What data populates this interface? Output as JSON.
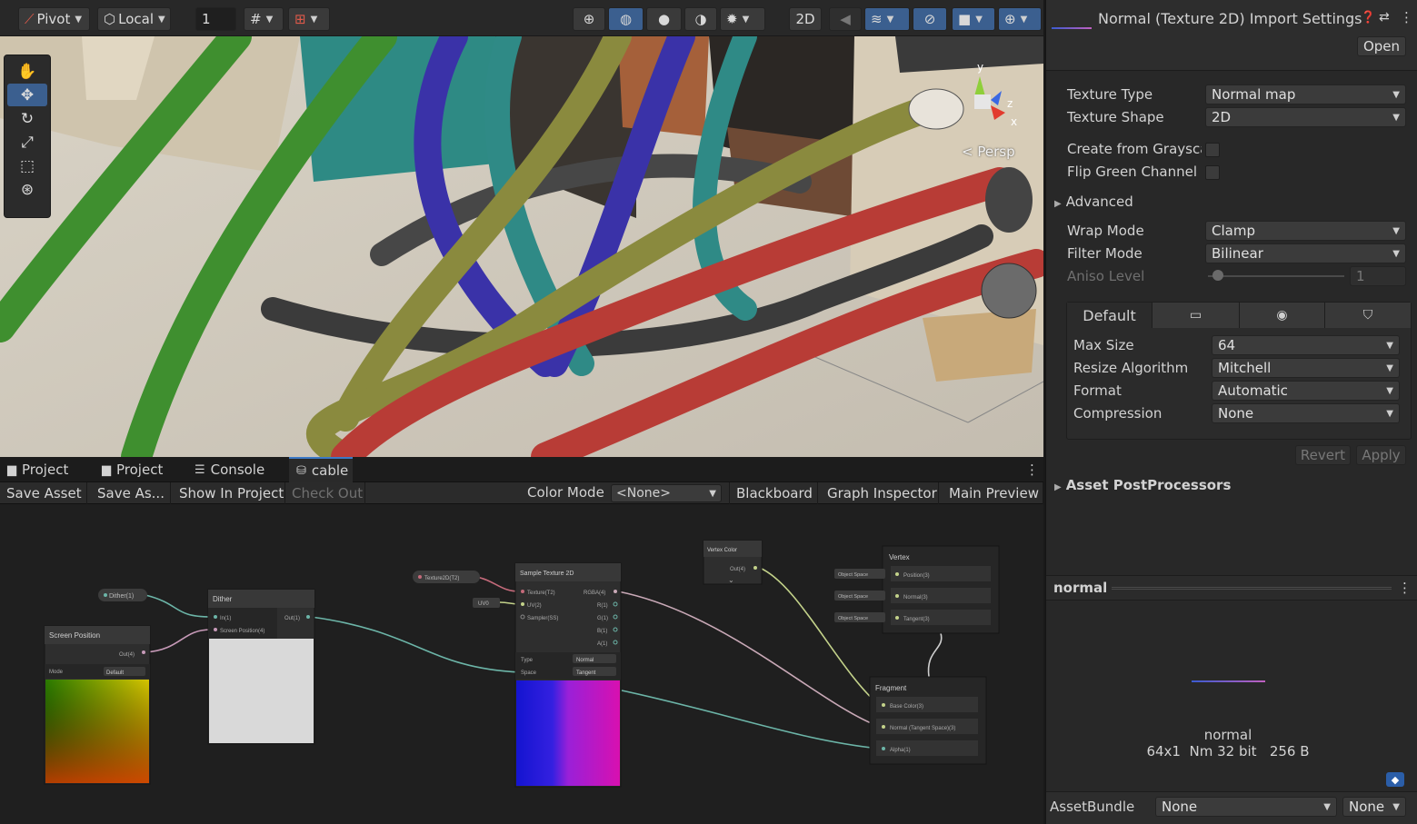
{
  "toolbar": {
    "pivot_label": "Pivot",
    "local_label": "Local",
    "grid_snap_value": "1",
    "toggle_2d_label": "2D"
  },
  "scene": {
    "view_mode_label": "Persp",
    "gizmo_axes": {
      "x": "x",
      "y": "y",
      "z": "z"
    },
    "tools": [
      "hand-tool",
      "move-tool",
      "rotate-tool",
      "scale-tool",
      "rect-tool",
      "transform-tool"
    ]
  },
  "graph_tabs": [
    {
      "label": "Project",
      "icon": "folder-icon"
    },
    {
      "label": "Project",
      "icon": "folder-icon"
    },
    {
      "label": "Console",
      "icon": "console-icon"
    },
    {
      "label": "cable",
      "icon": "shader-graph-icon"
    }
  ],
  "graph_toolbar": {
    "save_asset": "Save Asset",
    "save_as": "Save As...",
    "show_in_project": "Show In Project",
    "check_out": "Check Out",
    "color_mode_label": "Color Mode",
    "color_mode_value": "<None>",
    "blackboard": "Blackboard",
    "graph_inspector": "Graph Inspector",
    "main_preview": "Main Preview"
  },
  "graph_nodes": {
    "dither_prop": "Dither(1)",
    "dither": {
      "title": "Dither",
      "in_port": "In(1)",
      "screen_pos_port": "Screen Position(4)",
      "out_port": "Out(1)"
    },
    "screen_position": {
      "title": "Screen Position",
      "out_port": "Out(4)",
      "mode_label": "Mode",
      "mode_value": "Default"
    },
    "texture_prop": "Texture2D(T2)",
    "uv_pill": "UV0",
    "sample_texture": {
      "title": "Sample Texture 2D",
      "in_texture": "Texture(T2)",
      "in_uv": "UV(2)",
      "in_sampler": "Sampler(SS)",
      "out_rgba": "RGBA(4)",
      "out_r": "R(1)",
      "out_g": "G(1)",
      "out_b": "B(1)",
      "out_a": "A(1)",
      "type_label": "Type",
      "type_value": "Normal",
      "space_label": "Space",
      "space_value": "Tangent"
    },
    "vertex_color": {
      "title": "Vertex Color",
      "out_port": "Out(4)"
    },
    "vertex": {
      "title": "Vertex",
      "pos_pill": "Object Space",
      "pos_port": "Position(3)",
      "norm_pill": "Object Space",
      "norm_port": "Normal(3)",
      "tan_pill": "Object Space",
      "tan_port": "Tangent(3)"
    },
    "fragment": {
      "title": "Fragment",
      "base_color": "Base Color(3)",
      "normal": "Normal (Tangent Space)(3)",
      "alpha": "Alpha(1)"
    }
  },
  "inspector": {
    "title": "Normal (Texture 2D) Import Settings",
    "open_button": "Open",
    "texture_type_label": "Texture Type",
    "texture_type_value": "Normal map",
    "texture_shape_label": "Texture Shape",
    "texture_shape_value": "2D",
    "create_from_grayscale_label": "Create from Grayscal",
    "flip_green_label": "Flip Green Channel",
    "advanced_label": "Advanced",
    "wrap_mode_label": "Wrap Mode",
    "wrap_mode_value": "Clamp",
    "filter_mode_label": "Filter Mode",
    "filter_mode_value": "Bilinear",
    "aniso_label": "Aniso Level",
    "aniso_value": "1",
    "aniso_level_fraction": 0.0,
    "platform_tabs": [
      {
        "label": "Default",
        "icon": ""
      },
      {
        "label": "",
        "icon": "monitor-icon"
      },
      {
        "label": "",
        "icon": "android-icon"
      },
      {
        "label": "",
        "icon": "html5-icon"
      }
    ],
    "max_size_label": "Max Size",
    "max_size_value": "64",
    "resize_label": "Resize Algorithm",
    "resize_value": "Mitchell",
    "format_label": "Format",
    "format_value": "Automatic",
    "compression_label": "Compression",
    "compression_value": "None",
    "revert_button": "Revert",
    "apply_button": "Apply",
    "postprocessors_label": "Asset PostProcessors",
    "preview_title": "normal",
    "preview_name": "normal",
    "preview_info": "64x1  Nm 32 bit   256 B",
    "assetbundle_label": "AssetBundle",
    "assetbundle_value": "None",
    "assetbundle_variant": "None"
  },
  "colors": {
    "accent_blue": "#3b5f8f",
    "cable_green": "#3f8f2f",
    "cable_olive": "#8a8a3e",
    "cable_teal": "#2f8a86",
    "cable_blue": "#3a32a8",
    "cable_red": "#b83c36",
    "cable_dark": "#3b3b3b"
  }
}
